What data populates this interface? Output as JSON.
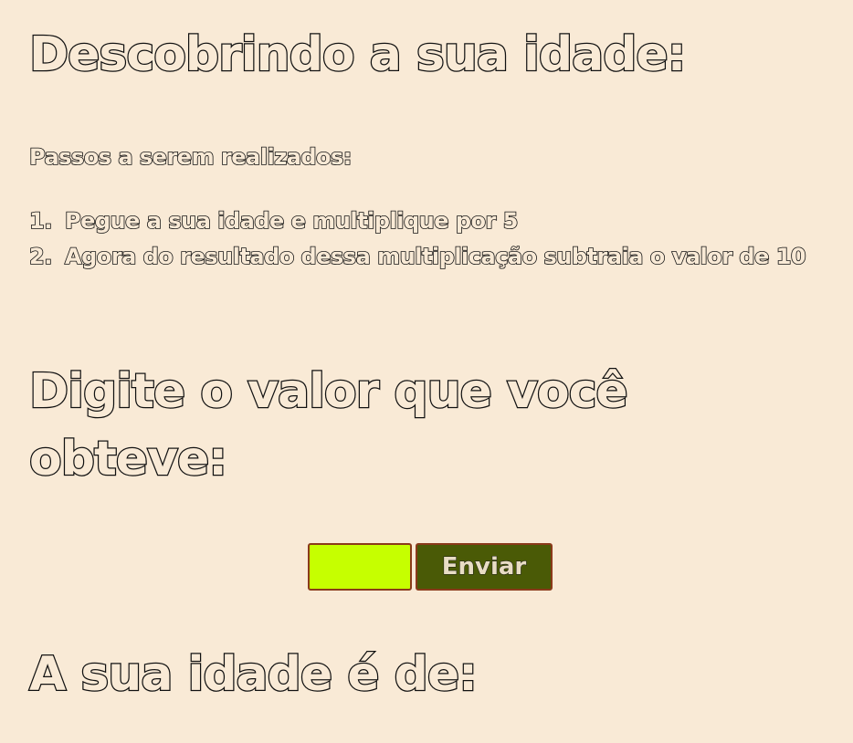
{
  "page": {
    "title": "Descobrindo a sua idade:",
    "steps_heading": "Passos a serem realizados:",
    "steps": [
      {
        "number": "1.",
        "text": "Pegue a sua idade e multiplique por 5"
      },
      {
        "number": "2.",
        "text": "Agora do resultado dessa multiplicação subtraia o valor de 10"
      }
    ],
    "prompt_heading": "Digite o valor que você obteve:",
    "form": {
      "input_value": "",
      "input_placeholder": "",
      "submit_label": "Enviar"
    },
    "result_heading": "A sua idade é de:"
  },
  "colors": {
    "background": "#f9ead6",
    "text_outline": "#111111",
    "input_background": "#c6ff00",
    "button_background": "#4a5a06",
    "control_border": "#8a3a1a"
  }
}
